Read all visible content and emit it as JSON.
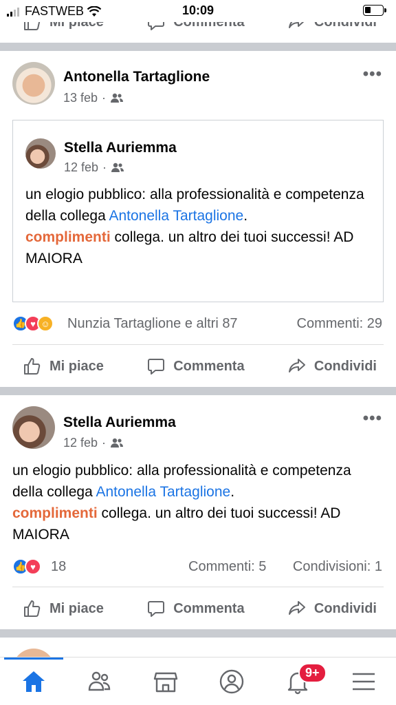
{
  "status_bar": {
    "carrier": "FASTWEB",
    "time": "10:09"
  },
  "actions": {
    "like": "Mi piace",
    "comment": "Commenta",
    "share": "Condividi"
  },
  "post1": {
    "author": "Antonella Tartaglione",
    "date": "13 feb",
    "shared": {
      "author": "Stella Auriemma",
      "date": "12 feb",
      "text_before": "un elogio pubblico: alla professionalità e competenza della collega ",
      "mention": "Antonella Tartaglione",
      "text_after": ".",
      "highlight": "complimenti",
      "text_tail": " collega. un altro dei tuoi successi! AD MAIORA"
    },
    "reactions_text": "Nunzia Tartaglione e altri 87",
    "comments_count": "Commenti: 29"
  },
  "post2": {
    "author": "Stella Auriemma",
    "date": "12 feb",
    "text_before": "un elogio pubblico: alla professionalità e competenza della collega ",
    "mention": "Antonella Tartaglione",
    "text_after": ".",
    "highlight": "complimenti",
    "text_tail": " collega. un altro dei tuoi successi! AD MAIORA",
    "reactions_count": "18",
    "comments_count": "Commenti: 5",
    "shares_count": "Condivisioni: 1"
  },
  "bottom_nav": {
    "tabs": [
      "home-icon",
      "friends-icon",
      "marketplace-icon",
      "profile-icon",
      "notifications-icon",
      "menu-icon"
    ],
    "notification_badge": "9+"
  },
  "colors": {
    "accent": "#1b74e4",
    "highlight": "#e4683a",
    "badge": "#e41e3f"
  }
}
